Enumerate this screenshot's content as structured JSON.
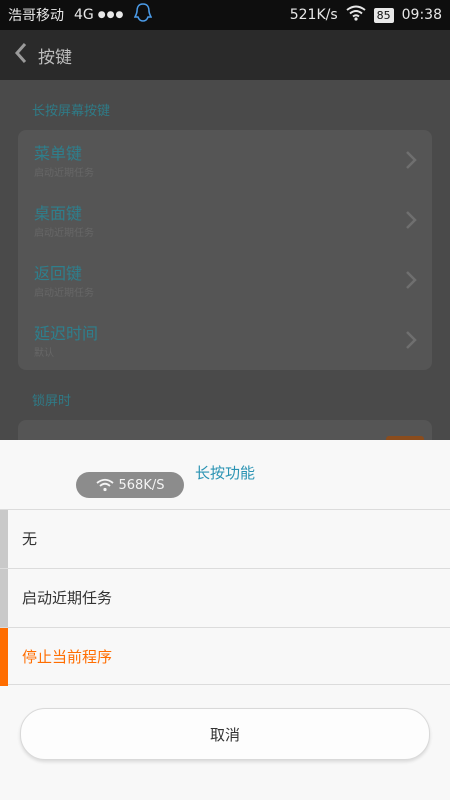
{
  "statusbar": {
    "carrier": "浩哥移动",
    "network": "4G",
    "dots": "●●●",
    "speed": "521K/s",
    "battery": "85",
    "time": "09:38"
  },
  "appbar": {
    "title": "按键"
  },
  "settings": {
    "section1_title": "长按屏幕按键",
    "rows": [
      {
        "label": "菜单键",
        "sub": "启动近期任务"
      },
      {
        "label": "桌面键",
        "sub": "启动近期任务"
      },
      {
        "label": "返回键",
        "sub": "启动近期任务"
      },
      {
        "label": "延迟时间",
        "sub": "默认"
      }
    ],
    "section2_title": "锁屏时"
  },
  "sheet": {
    "title": "长按功能",
    "speed_overlay": "568K/S",
    "options": [
      {
        "label": "无",
        "selected": false
      },
      {
        "label": "启动近期任务",
        "selected": false
      },
      {
        "label": "停止当前程序",
        "selected": true
      }
    ],
    "cancel": "取消"
  },
  "colors": {
    "accent_orange": "#ff6d00",
    "title_blue": "#2a93b3",
    "marker_gray": "#c7c7c7"
  }
}
